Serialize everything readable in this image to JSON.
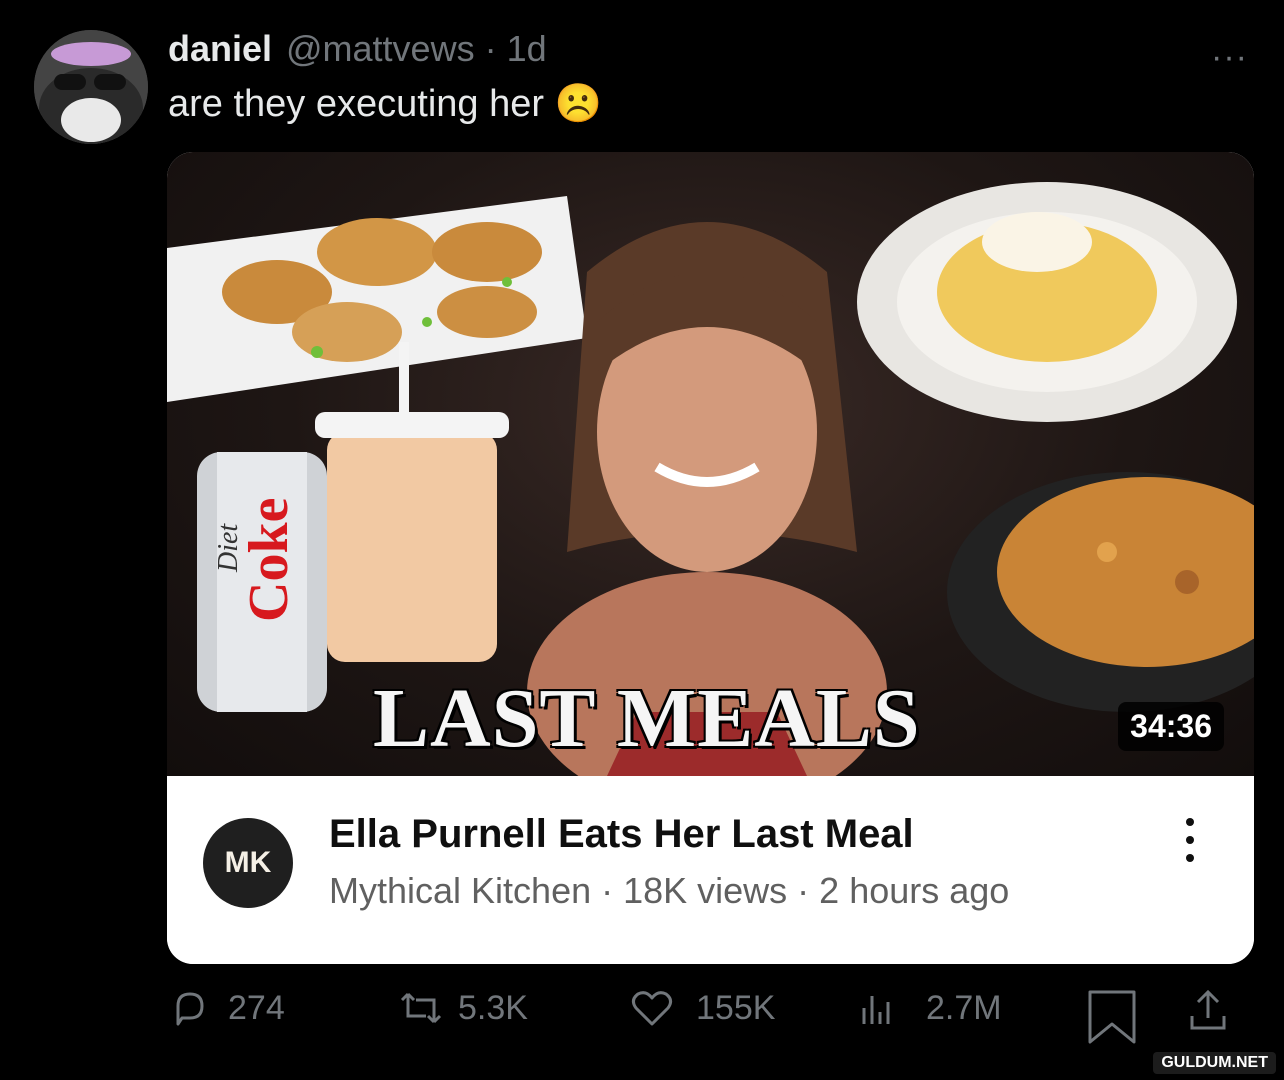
{
  "tweet": {
    "name": "daniel",
    "handle_time": "@mattvews · 1d",
    "text": "are they executing her ☹️",
    "more": "···"
  },
  "video": {
    "thumbnail_title": "LAST MEALS",
    "duration": "34:36",
    "channel_logo_text": "MK",
    "title": "Ella Purnell Eats Her Last Meal",
    "meta": "Mythical Kitchen · 18K views · 2 hours ago",
    "can_label": "Diet Coke"
  },
  "actions": {
    "replies": "274",
    "reposts": "5.3K",
    "likes": "155K",
    "views": "2.7M"
  },
  "watermark": "GULDUM.NET"
}
